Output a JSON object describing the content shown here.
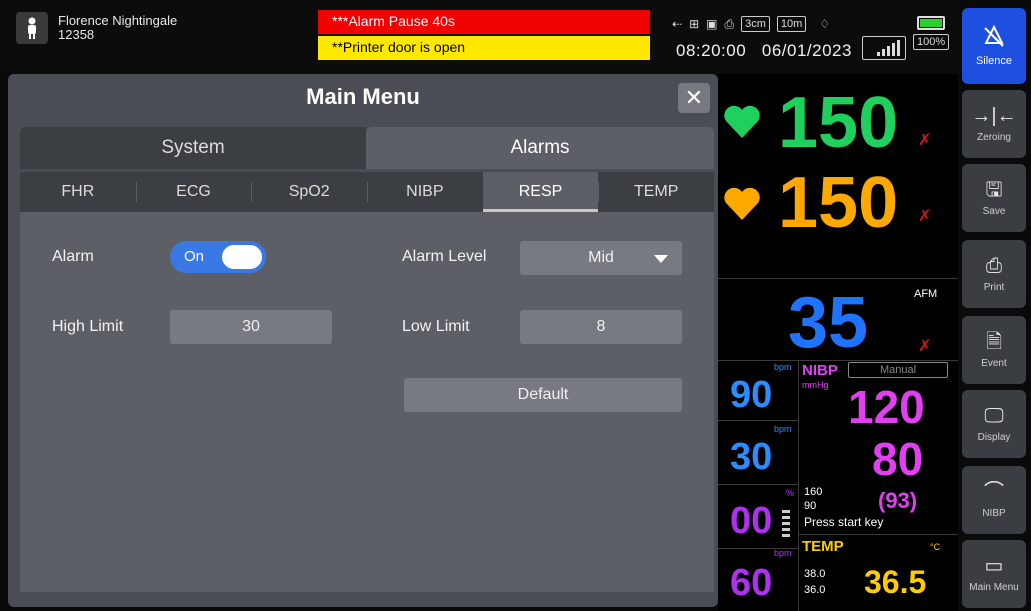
{
  "patient": {
    "name": "Florence Nightingale",
    "id": "12358"
  },
  "alarms": {
    "high": "***Alarm Pause 40s",
    "info": "**Printer door is open"
  },
  "status": {
    "scale1": "3cm",
    "scale2": "10m",
    "time": "08:20:00",
    "date": "06/01/2023",
    "battery": "100%"
  },
  "sidebar": {
    "silence": "Silence",
    "zeroing": "Zeroing",
    "save": "Save",
    "print": "Print",
    "event": "Event",
    "display": "Display",
    "nibp": "NIBP",
    "main_menu": "Main Menu"
  },
  "dialog": {
    "title": "Main Menu",
    "tabs": [
      "System",
      "Alarms"
    ],
    "subtabs": [
      "FHR",
      "ECG",
      "SpO2",
      "NIBP",
      "RESP",
      "TEMP"
    ],
    "alarm_label": "Alarm",
    "alarm_value": "On",
    "alarm_level_label": "Alarm Level",
    "alarm_level_value": "Mid",
    "high_limit_label": "High Limit",
    "high_limit_value": "30",
    "low_limit_label": "Low Limit",
    "low_limit_value": "8",
    "default_label": "Default"
  },
  "vitals": {
    "fhr1": "150",
    "fhr2": "150",
    "afm": "35",
    "afm_label": "AFM",
    "hr": "90",
    "bpm": "bpm",
    "resp": "30",
    "spo2": "00",
    "spo2_unit": "%",
    "pr": "60",
    "nibp_label": "NIBP",
    "nibp_mode": "Manual",
    "nibp_unit": "mmHg",
    "sys": "120",
    "dia": "80",
    "map": "(93)",
    "nibp_high": "160",
    "nibp_low": "90",
    "nibp_msg": "Press start key",
    "temp_label": "TEMP",
    "temp_unit": "°C",
    "temp": "36.5",
    "temp_high": "38.0",
    "temp_low": "36.0"
  },
  "colors": {
    "fhr1": "#1fd15c",
    "fhr2": "#ffa800",
    "afm": "#1e74ff",
    "nibp": "#e040f0",
    "temp": "#ffcc00",
    "silence": "#1d4fe0"
  }
}
